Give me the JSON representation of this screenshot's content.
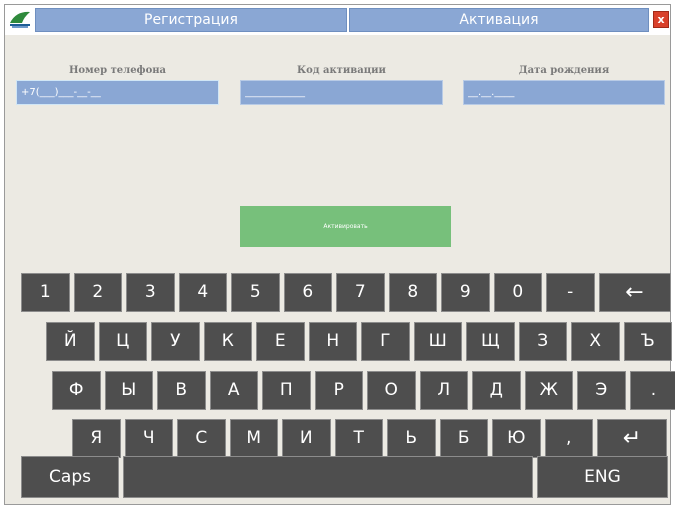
{
  "tabs": {
    "registration": "Регистрация",
    "activation": "Активация",
    "close": "x"
  },
  "form": {
    "phone_label": "Номер телефона",
    "phone_placeholder": "+7(___)___-__-__",
    "code_label": "Код активации",
    "code_placeholder": "____________",
    "dob_label": "Дата рождения",
    "dob_placeholder": "__.__.____",
    "activate_button": "Активировать"
  },
  "keyboard": {
    "row1": [
      "1",
      "2",
      "3",
      "4",
      "5",
      "6",
      "7",
      "8",
      "9",
      "0",
      "-",
      "←"
    ],
    "row2": [
      "Й",
      "Ц",
      "У",
      "К",
      "Е",
      "Н",
      "Г",
      "Ш",
      "Щ",
      "З",
      "Х",
      "Ъ"
    ],
    "row3": [
      "Ф",
      "Ы",
      "В",
      "А",
      "П",
      "Р",
      "О",
      "Л",
      "Д",
      "Ж",
      "Э",
      "."
    ],
    "row4": [
      "Я",
      "Ч",
      "С",
      "М",
      "И",
      "Т",
      "Ь",
      "Б",
      "Ю",
      ",",
      "↵"
    ],
    "caps": "Caps",
    "space": "",
    "lang": "ENG"
  },
  "colors": {
    "tab": "#8aa7d4",
    "field": "#8aa7d4",
    "activate": "#77c07b",
    "key": "#4e4e4e",
    "close": "#d9412b"
  }
}
